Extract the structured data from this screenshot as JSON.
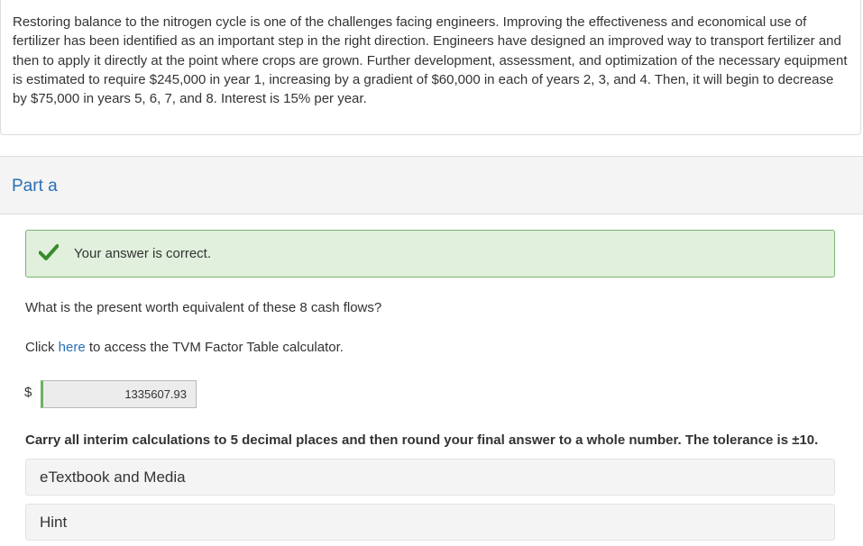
{
  "problem": {
    "text": "Restoring balance to the nitrogen cycle is one of the challenges facing engineers. Improving the effectiveness and economical use of fertilizer has been identified as an important step in the right direction. Engineers have designed an improved way to transport fertilizer and then to apply it directly at the point where crops are grown. Further development, assessment, and optimization of the necessary equipment is estimated to require $245,000 in year 1, increasing by a gradient of $60,000 in each of years 2, 3, and 4. Then, it will begin to decrease by $75,000 in years 5, 6, 7, and 8. Interest is 15% per year."
  },
  "part": {
    "title": "Part a",
    "feedback": {
      "message": "Your answer is correct.",
      "icon": "check-icon",
      "color": "#3a8a2e"
    },
    "question": "What is the present worth equivalent of these 8 cash flows?",
    "tvm": {
      "prefix": "Click ",
      "link": "here",
      "suffix": " to access the TVM Factor Table calculator."
    },
    "answer": {
      "currency": "$",
      "value": "1335607.93"
    },
    "instructions": "Carry all interim calculations to 5 decimal places and then round your final answer to a whole number. The tolerance is ±10.",
    "resources": {
      "etextbook": "eTextbook and Media",
      "hint": "Hint"
    }
  }
}
